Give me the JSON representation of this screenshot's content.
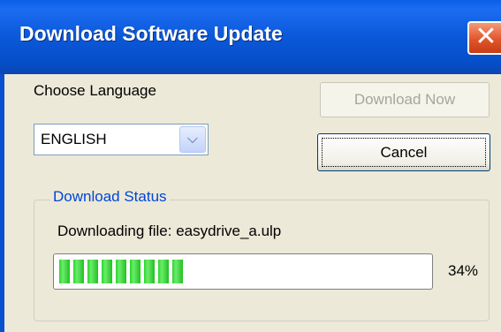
{
  "window": {
    "title": "Download Software Update",
    "close_symbol": "✕"
  },
  "language": {
    "label": "Choose Language",
    "selected": "ENGLISH",
    "dropdown_icon": "chevron-down-icon"
  },
  "buttons": {
    "download_now": "Download Now",
    "download_now_enabled": false,
    "cancel": "Cancel"
  },
  "status": {
    "group_label": "Download Status",
    "message": "Downloading file: easydrive_a.ulp",
    "progress_percent": 34,
    "progress_label": "34%"
  },
  "colors": {
    "titlebar": "#0a5fe6",
    "progress_fill": "#2bd42b",
    "group_label": "#0046d5"
  }
}
